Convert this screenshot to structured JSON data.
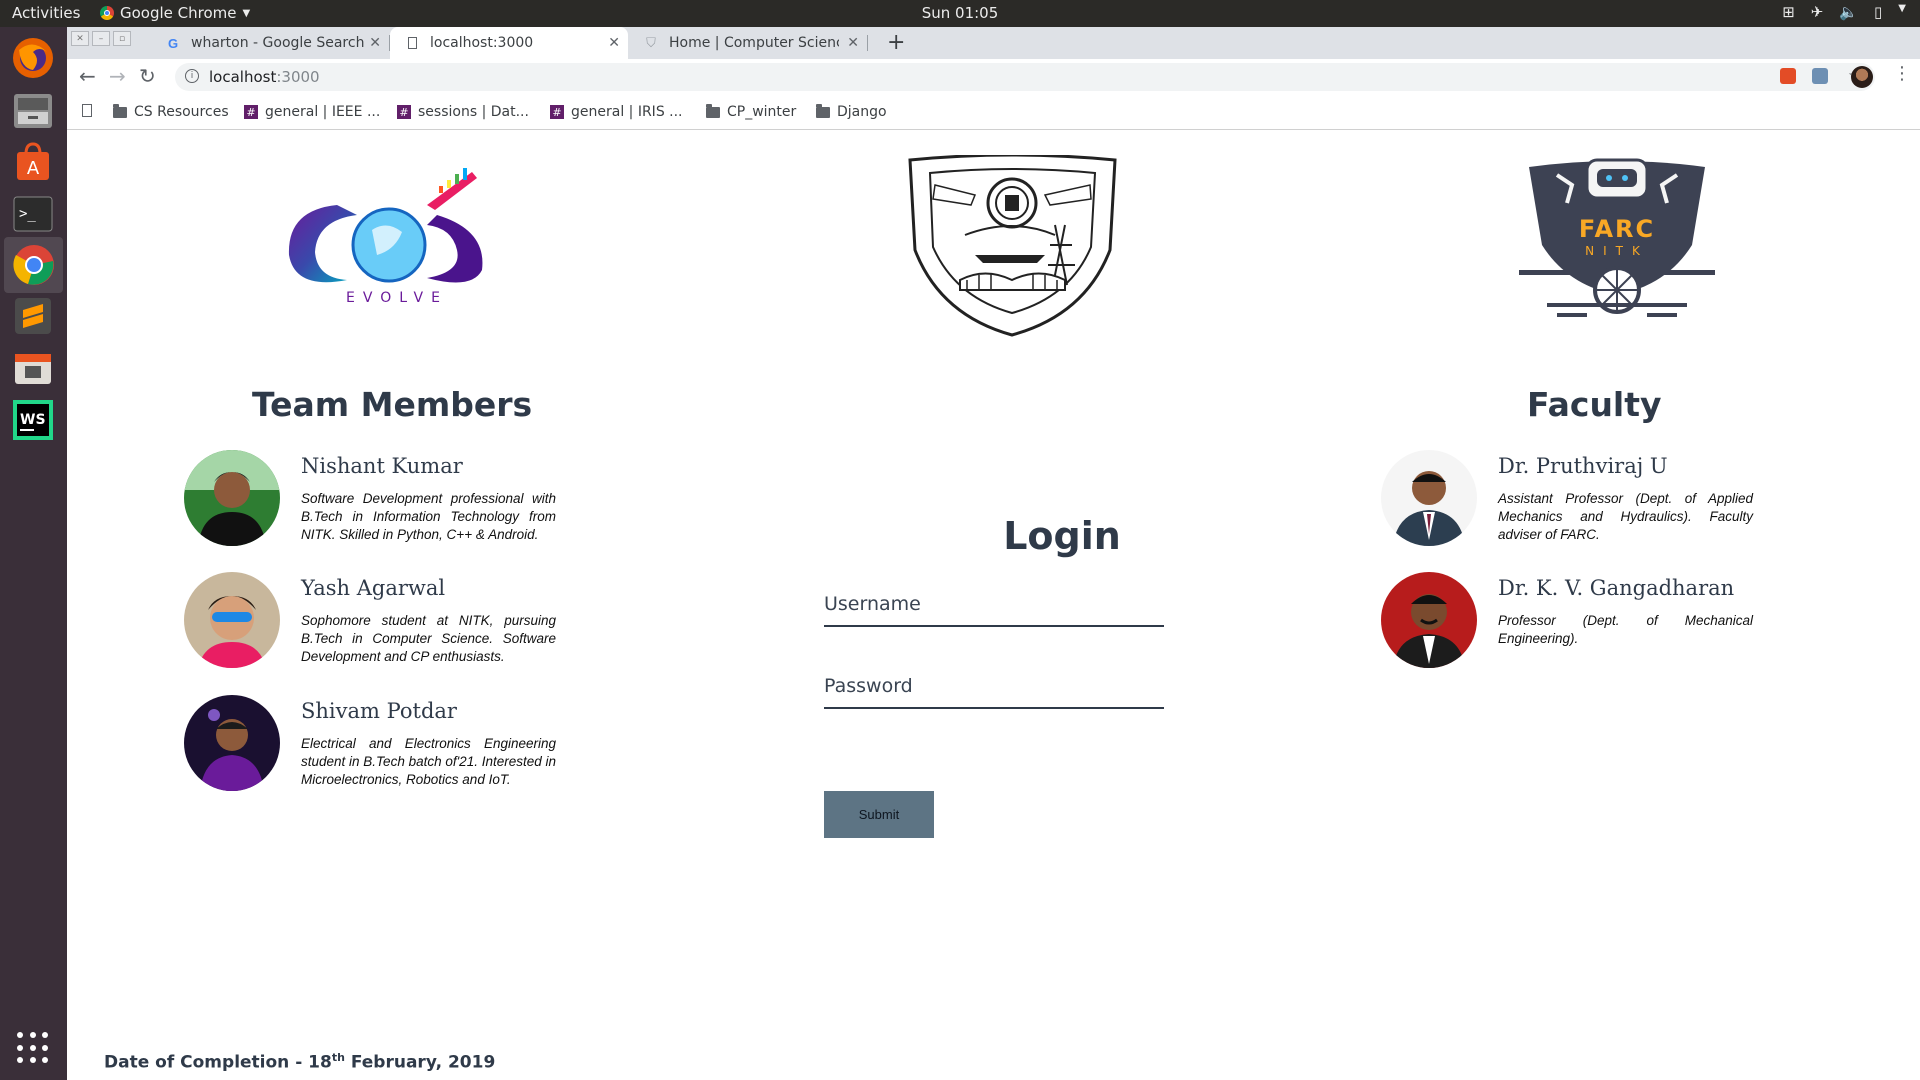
{
  "topbar": {
    "activities": "Activities",
    "app_name": "Google Chrome",
    "clock": "Sun 01:05"
  },
  "browser": {
    "tabs": [
      {
        "title": "wharton - Google Search",
        "favicon": "google-icon"
      },
      {
        "title": "localhost:3000",
        "favicon": "page-icon",
        "active": true
      },
      {
        "title": "Home | Computer Science",
        "favicon": "shield-icon"
      }
    ],
    "url_host": "localhost",
    "url_port": ":3000",
    "bookmarks": [
      {
        "label": "CS Resources",
        "icon": "folder-icon"
      },
      {
        "label": "general | IEEE ...",
        "icon": "slack-icon"
      },
      {
        "label": "sessions | Dat...",
        "icon": "slack-icon"
      },
      {
        "label": "general | IRIS ...",
        "icon": "slack-icon"
      },
      {
        "label": "CP_winter",
        "icon": "folder-icon"
      },
      {
        "label": "Django",
        "icon": "folder-icon"
      }
    ]
  },
  "page": {
    "logos": {
      "evolve": "EVOLVE",
      "farc_top": "FARC",
      "farc_bottom": "NITK"
    },
    "team_title": "Team Members",
    "team": [
      {
        "name": "Nishant Kumar",
        "desc": "Software Development professional with B.Tech in Information Technology from NITK. Skilled in Python, C++ & Android."
      },
      {
        "name": "Yash Agarwal",
        "desc": "Sophomore student at NITK, pursuing B.Tech in Computer Science. Software Development and CP enthusiasts."
      },
      {
        "name": "Shivam Potdar",
        "desc": "Electrical and Electronics Engineering student in B.Tech batch of'21. Interested in Microelectronics, Robotics and IoT."
      }
    ],
    "faculty_title": "Faculty",
    "faculty": [
      {
        "name": "Dr. Pruthviraj U",
        "desc": "Assistant Professor (Dept. of Applied Mechanics and Hydraulics). Faculty adviser of FARC."
      },
      {
        "name": "Dr. K. V. Gangadharan",
        "desc": "Professor (Dept. of Mechanical Engineering)."
      }
    ],
    "login": {
      "title": "Login",
      "username_placeholder": "Username",
      "password_placeholder": "Password",
      "submit": "Submit"
    },
    "footer": {
      "prefix": "Date of Completion - 18",
      "sup": "th",
      "suffix": " February, 2019"
    }
  }
}
